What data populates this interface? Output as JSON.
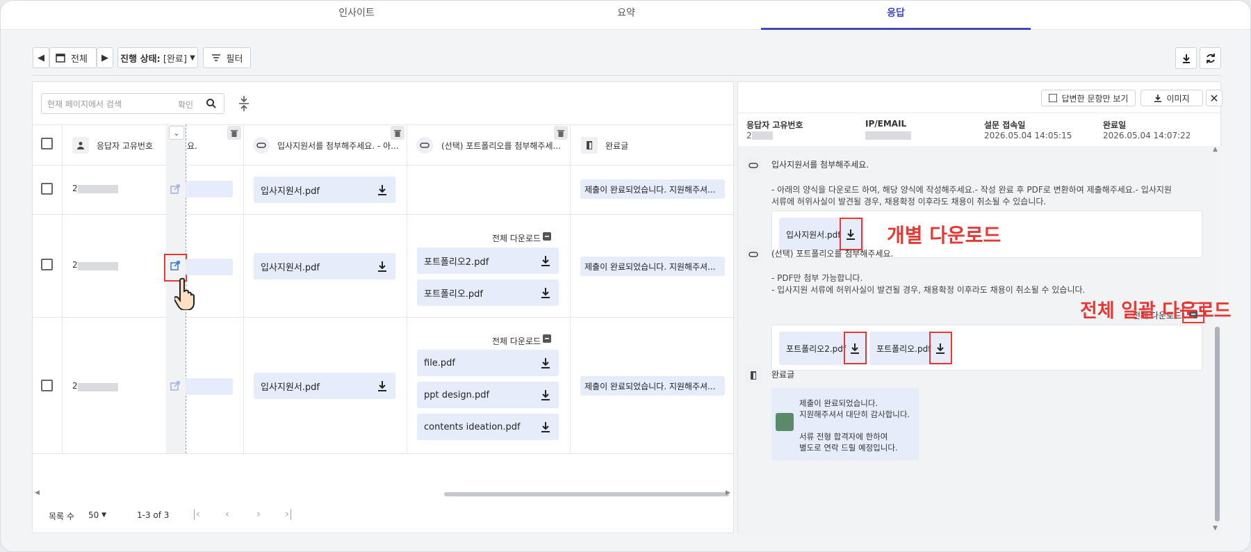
{
  "tabs": [
    {
      "label": "인사이트"
    },
    {
      "label": "요약"
    },
    {
      "label": "응답"
    }
  ],
  "toolbar": {
    "range_label": "전체",
    "status_prefix": "진행 상태:",
    "status_value": "[완료]",
    "filter_label": "필터"
  },
  "table": {
    "search_placeholder": "현재 페이지에서 검색",
    "search_confirm": "확인",
    "headers": {
      "respondent_id": "응답자 고유번호",
      "partial": "요.",
      "resume": "입사지원서를 첨부해주세요. - 아...",
      "portfolio": "(선택) 포트폴리오를 첨부해주세...",
      "completion": "완료글"
    },
    "rows": [
      {
        "id": "2",
        "resume": "입사지원서.pdf",
        "completion": "제출이 완료되었습니다. 지원해주셔...",
        "files": []
      },
      {
        "id": "2",
        "resume": "입사지원서.pdf",
        "completion": "제출이 완료되었습니다. 지원해주셔...",
        "download_all": "전체 다운로드",
        "files": [
          "포트폴리오2.pdf",
          "포트폴리오.pdf"
        ]
      },
      {
        "id": "2",
        "resume": "입사지원서.pdf",
        "completion": "제출이 완료되었습니다. 지원해주셔...",
        "download_all": "전체 다운로드",
        "files": [
          "file.pdf",
          "ppt design.pdf",
          "contents ideation.pdf"
        ]
      }
    ],
    "footer": {
      "rows_label": "목록 수",
      "rows_value": "50",
      "range": "1-3 of 3"
    }
  },
  "detail": {
    "answered_only": "답변한 문항만 보기",
    "image_btn": "이미지",
    "meta": [
      {
        "label": "응답자 고유번호",
        "value": "2"
      },
      {
        "label": "IP/EMAIL",
        "value": ""
      },
      {
        "label": "설문 접속일",
        "value": "2026.05.04 14:05:15"
      },
      {
        "label": "완료일",
        "value": "2026.05.04 14:07:22"
      }
    ],
    "q1": {
      "title": "입사지원서를 첨부해주세요.",
      "desc": "- 아래의 양식을 다운로드 하여, 해당 양식에 작성해주세요.- 작성 완료 후 PDF로 변환하여 제출해주세요.- 입사지원",
      "desc2": "서류에 허위사실이 발견될 경우, 채용확정 이후라도 채용이 취소될 수 있습니다.",
      "file": "입사지원서.pdf"
    },
    "q2": {
      "title": "(선택) 포트폴리오를 첨부해주세요.",
      "desc": "- PDF만 첨부 가능합니다.",
      "desc2": "- 입사지원 서류에 허위사실이 발견될 경우, 채용확정 이후라도 채용이 취소될 수 있습니다.",
      "download_all": "전체 다운로드",
      "files": [
        "포트폴리오2.pdf",
        "포트폴리오.pdf"
      ]
    },
    "completion": {
      "title": "완료글",
      "lines": [
        "제출이 완료되었습니다.",
        "지원해주셔서 대단히 감사합니다.",
        "",
        "서류 전형 합격자에 한하여",
        "별도로 연락 드릴 예정입니다."
      ]
    }
  },
  "annotations": {
    "individual": "개별 다운로드",
    "bulk": "전체 일괄 다운로드"
  },
  "colors": {
    "accent": "#3b4db5",
    "annotation": "#e53935",
    "file_bg": "#e7ecfb"
  }
}
